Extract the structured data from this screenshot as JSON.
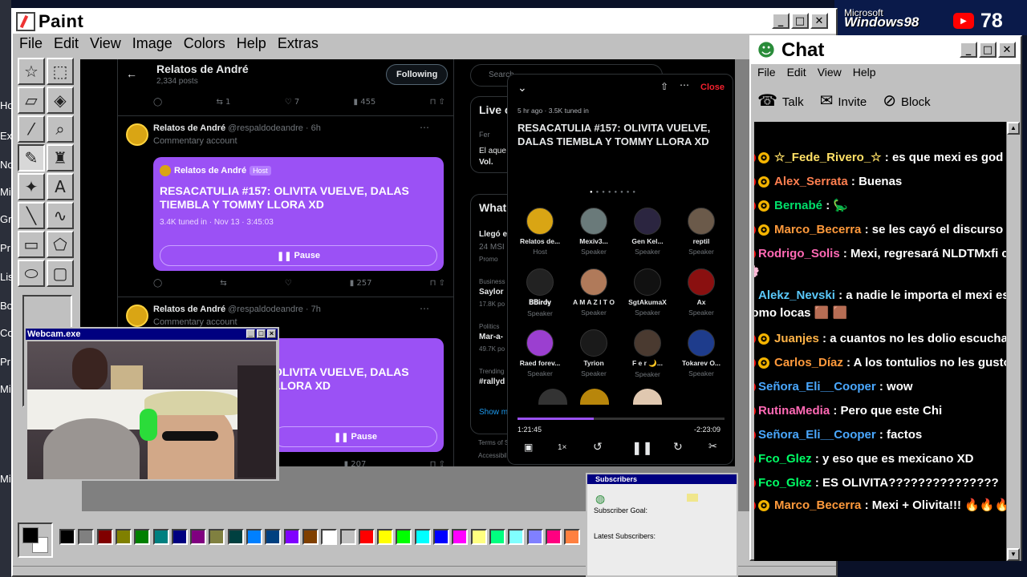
{
  "desktop": {
    "fragments": [
      "Ho",
      "Ex",
      "No",
      "Mi",
      "Gr",
      "Pr",
      "Lis",
      "Bo",
      "Co",
      "Pr",
      "Mi",
      "Mi"
    ],
    "brand_top": "Microsoft",
    "brand": "Windows98",
    "subscriber_count": "78"
  },
  "paint": {
    "title": "Paint",
    "menu": [
      "File",
      "Edit",
      "View",
      "Image",
      "Colors",
      "Help",
      "Extras"
    ],
    "tools": [
      "free-select",
      "rect-select",
      "eraser",
      "fill",
      "picker",
      "magnifier",
      "pencil",
      "brush",
      "airbrush",
      "text",
      "line",
      "curve",
      "rectangle",
      "polygon",
      "ellipse",
      "rounded-rect"
    ],
    "palette": [
      "#000000",
      "#808080",
      "#800000",
      "#808000",
      "#008000",
      "#008080",
      "#000080",
      "#800080",
      "#808040",
      "#004040",
      "#0080ff",
      "#004080",
      "#8000ff",
      "#804000",
      "#ffffff",
      "#c0c0c0",
      "#ff0000",
      "#ffff00",
      "#00ff00",
      "#00ffff",
      "#0000ff",
      "#ff00ff",
      "#ffff80",
      "#00ff80",
      "#80ffff",
      "#8080ff",
      "#ff0080",
      "#ff8040"
    ]
  },
  "twitter": {
    "back_icon": "←",
    "profile_name": "Relatos de André",
    "profile_posts": "2,334 posts",
    "follow_label": "Following",
    "search_placeholder": "Search",
    "top_actions": {
      "reply": "",
      "retweet": "1",
      "like": "7",
      "views": "455"
    },
    "posts": [
      {
        "name": "Relatos de André",
        "handle": "@respaldodeandre · 6h",
        "sub": "Commentary account",
        "card_host": "Relatos de André",
        "card_host_badge": "Host",
        "card_title": "RESACATULIA #157: OLIVITA VUELVE, DALAS TIEMBLA Y TOMMY LLORA XD",
        "card_meta": "3.4K tuned in · Nov 13 · 3:45:03",
        "card_button": "Pause",
        "views": "257"
      },
      {
        "name": "Relatos de André",
        "handle": "@respaldodeandre · 7h",
        "sub": "Commentary account",
        "card_title": "OLIVITA VUELVE, DALAS LLORA XD",
        "card_button": "Pause",
        "views": "207"
      }
    ],
    "sidebar": {
      "live_title": "Live o",
      "live_user": "Fer",
      "live_text": "El aque",
      "live_vol": "Vol.",
      "whats_title": "What",
      "trend1_a": "Llegó e",
      "trend1_b": "24 MSI",
      "trend1_c": "Promo",
      "trend2_cat": "Business",
      "trend2_title": "Saylor",
      "trend2_count": "17.8K po",
      "trend3_cat": "Politics",
      "trend3_title": "Mar-a-",
      "trend3_count": "49.7K po",
      "trend4_cat": "Trending",
      "trend4_title": "#rallyd",
      "show_more": "Show m",
      "footer_a": "Terms of S",
      "footer_b": "Accessibil"
    }
  },
  "space": {
    "close_label": "Close",
    "meta": "5 hr ago · 3.5K tuned in",
    "title": "RESACATULIA #157: OLIVITA VUELVE, DALAS TIEMBLA Y TOMMY LLORA XD",
    "people": [
      {
        "name": "Relatos de...",
        "role": "Host",
        "color": "#d9a514"
      },
      {
        "name": "Mexiv3...",
        "role": "Speaker",
        "color": "#6a7a7a"
      },
      {
        "name": "Gen Kel...",
        "role": "Speaker",
        "color": "#2b2540"
      },
      {
        "name": "reptil",
        "role": "Speaker",
        "color": "#6b5a4a"
      },
      {
        "name": "𝐁𝐁𝐢𝐫𝐝𝐲",
        "role": "Speaker",
        "color": "#222222"
      },
      {
        "name": "A M A Z I T O",
        "role": "Speaker",
        "color": "#b07a5a"
      },
      {
        "name": "SgtAkumaX",
        "role": "Speaker",
        "color": "#111111"
      },
      {
        "name": "Ax",
        "role": "Speaker",
        "color": "#8a1010"
      },
      {
        "name": "Raed forev...",
        "role": "Speaker",
        "color": "#9b3fd0"
      },
      {
        "name": "Tyrion",
        "role": "Speaker",
        "color": "#1a1a1a"
      },
      {
        "name": "F e r 🌙...",
        "role": "Speaker",
        "color": "#4a3a30"
      },
      {
        "name": "Tokarev O...",
        "role": "Speaker",
        "color": "#1e3c8c"
      }
    ],
    "time_elapsed": "1:21:45",
    "time_left": "-2:23:09",
    "progress": 0.37,
    "speed": "1×"
  },
  "webcam": {
    "title": "Webcam.exe"
  },
  "chat": {
    "title": "Chat",
    "menu": [
      "File",
      "Edit",
      "View",
      "Help"
    ],
    "tools": [
      {
        "label": "Talk",
        "icon": "☎"
      },
      {
        "label": "Invite",
        "icon": "✉"
      },
      {
        "label": "Block",
        "icon": "⊘"
      }
    ],
    "messages": [
      {
        "user": "☆_Fede_Rivero_☆",
        "color": "#ffe066",
        "text": ": es que mexi es god",
        "badges": [
          "b",
          "s"
        ]
      },
      {
        "user": "Alex_Serrata",
        "color": "#ff7f50",
        "text": ": Buenas",
        "badges": [
          "b",
          "s"
        ]
      },
      {
        "user": "Bernabé",
        "color": "#00e06a",
        "text": ": 🦕",
        "badges": [
          "b",
          "s"
        ]
      },
      {
        "user": "Marco_Becerra",
        "color": "#ff9a3c",
        "text": ": se les cayó el discurso a lo",
        "badges": [
          "b",
          "s"
        ]
      },
      {
        "user": "Rodrigo_Solis",
        "color": "#ff69b4",
        "text": ": Mexi, regresará NLDTMxfi con",
        "badges": [
          "b"
        ]
      },
      {
        "user": "",
        "color": "#ffffff",
        "text": "🌸",
        "badges": []
      },
      {
        "user": "Alekz_Nevski",
        "color": "#5ac8fa",
        "text": ": a nadie le importa el mexi ese?",
        "badges": [
          "k"
        ]
      },
      {
        "user": "",
        "color": "#ffffff",
        "text": "como locas 🟫 🟫",
        "badges": []
      },
      {
        "user": "Juanjes",
        "color": "#ffb347",
        "text": ": a cuantos no les dolio escuchar es",
        "badges": [
          "b",
          "s"
        ]
      },
      {
        "user": "Carlos_Díaz",
        "color": "#ff9a3c",
        "text": ": A los tontulios no les gustó es",
        "badges": [
          "b",
          "s"
        ]
      },
      {
        "user": "Señora_Eli__Cooper",
        "color": "#4aa8ff",
        "text": ": wow",
        "badges": [
          "b"
        ]
      },
      {
        "user": "RutinaMedia",
        "color": "#ff69b4",
        "text": ": Pero que este Chi",
        "badges": [
          "b"
        ]
      },
      {
        "user": "Señora_Eli__Cooper",
        "color": "#4aa8ff",
        "text": ": factos",
        "badges": [
          "b"
        ]
      },
      {
        "user": "Fco_Glez",
        "color": "#00ff66",
        "text": ": y eso que es mexicano XD",
        "badges": [
          "b"
        ]
      },
      {
        "user": "Fco_Glez",
        "color": "#00ff66",
        "text": ": ES OLIVITA???????????????",
        "badges": [
          "b"
        ]
      },
      {
        "user": "Marco_Becerra",
        "color": "#ff9a3c",
        "text": ": Mexi + Olivita!!! 🔥🔥🔥🔥",
        "badges": [
          "b",
          "s"
        ]
      }
    ]
  },
  "subscribers": {
    "title": "Subscribers",
    "goal_label": "Subscriber Goal:",
    "latest_label": "Latest Subscribers:"
  }
}
